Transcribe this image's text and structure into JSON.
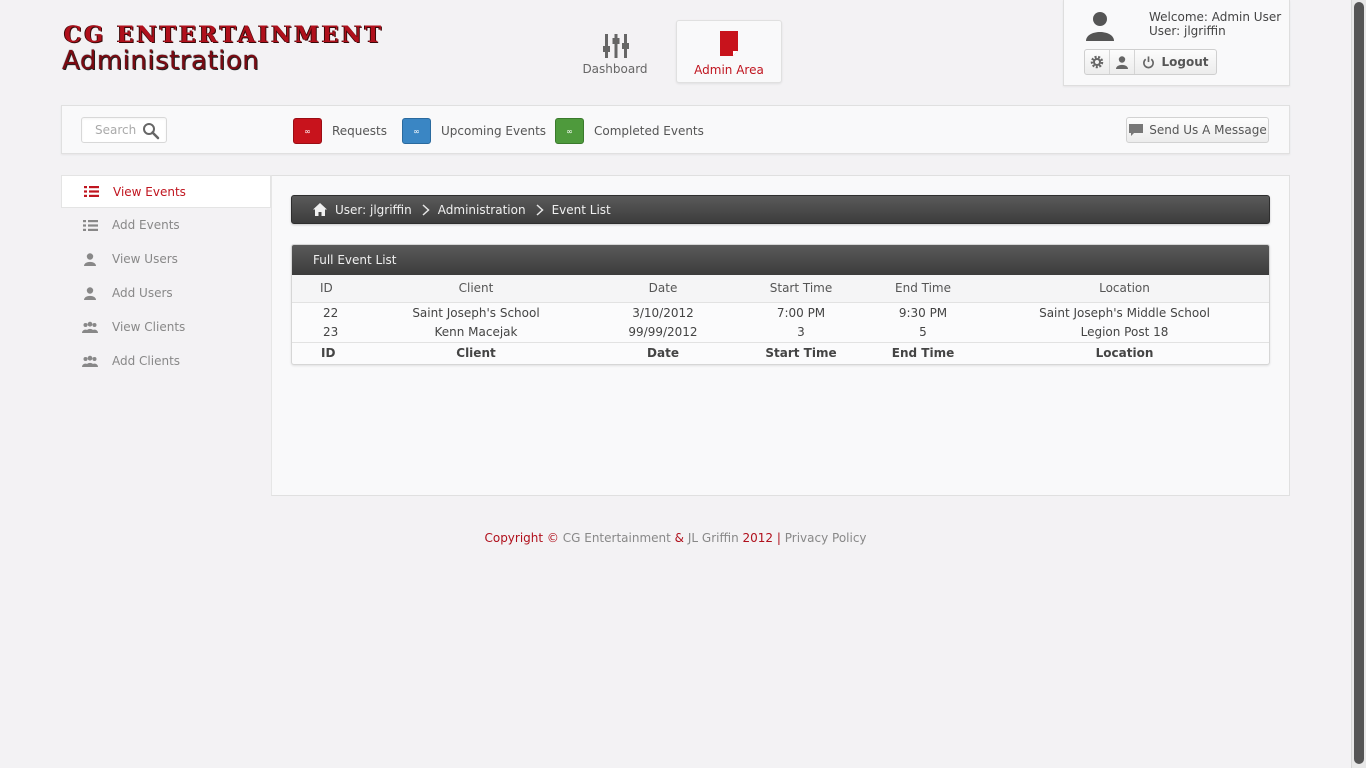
{
  "brand": {
    "line1": "CG Entertainment",
    "line2": "Administration"
  },
  "topnav": {
    "dashboard": "Dashboard",
    "admin": "Admin Area"
  },
  "user_panel": {
    "welcome": "Welcome: Admin User",
    "user": "User: jlgriffin",
    "logout": "Logout"
  },
  "toolbar": {
    "search_placeholder": "Search",
    "requests": "Requests",
    "upcoming": "Upcoming Events",
    "completed": "Completed Events",
    "message": "Send Us A Message",
    "colors": {
      "requests": "#c8131c",
      "upcoming": "#3a86c4",
      "completed": "#4e9a3c"
    }
  },
  "sidebar": {
    "items": [
      {
        "label": "View Events",
        "icon": "list-icon",
        "active": true
      },
      {
        "label": "Add Events",
        "icon": "list-icon",
        "active": false
      },
      {
        "label": "View Users",
        "icon": "user-icon",
        "active": false
      },
      {
        "label": "Add Users",
        "icon": "user-icon",
        "active": false
      },
      {
        "label": "View Clients",
        "icon": "group-icon",
        "active": false
      },
      {
        "label": "Add Clients",
        "icon": "group-icon",
        "active": false
      }
    ]
  },
  "breadcrumb": {
    "items": [
      "User: jlgriffin",
      "Administration",
      "Event List"
    ]
  },
  "event_list": {
    "title": "Full Event List",
    "columns": [
      "ID",
      "Client",
      "Date",
      "Start Time",
      "End Time",
      "Location"
    ],
    "rows": [
      [
        "22",
        "Saint Joseph's School",
        "3/10/2012",
        "7:00 PM",
        "9:30 PM",
        "Saint Joseph's Middle School"
      ],
      [
        "23",
        "Kenn Macejak",
        "99/99/2012",
        "3",
        "5",
        "Legion Post 18"
      ]
    ]
  },
  "footer": {
    "copyright": "Copyright ©",
    "company": "CG Entertainment",
    "amp": "&",
    "author": "JL Griffin",
    "year": "2012",
    "pipe": "|",
    "privacy": "Privacy Policy"
  },
  "accent_color": "#c0151f"
}
